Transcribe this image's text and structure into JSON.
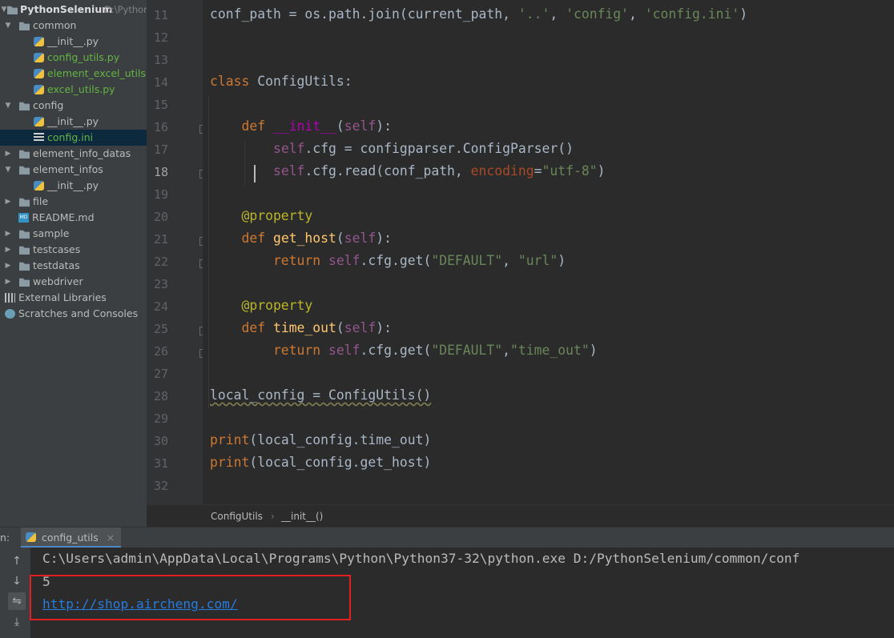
{
  "project_tree": {
    "root_name": "PythonSelenium",
    "root_path": "D:\\Pythor",
    "items": [
      {
        "label": "common",
        "type": "folder",
        "expanded": true
      },
      {
        "label": "__init__.py",
        "type": "py"
      },
      {
        "label": "config_utils.py",
        "type": "py",
        "status": "added"
      },
      {
        "label": "element_excel_utils.py",
        "type": "py",
        "status": "added"
      },
      {
        "label": "excel_utils.py",
        "type": "py",
        "status": "added"
      },
      {
        "label": "config",
        "type": "folder",
        "expanded": true
      },
      {
        "label": "__init__.py",
        "type": "py"
      },
      {
        "label": "config.ini",
        "type": "ini",
        "status": "added",
        "selected": true
      },
      {
        "label": "element_info_datas",
        "type": "folder",
        "expanded": false
      },
      {
        "label": "element_infos",
        "type": "folder",
        "expanded": true
      },
      {
        "label": "__init__.py",
        "type": "py"
      },
      {
        "label": "file",
        "type": "folder",
        "expanded": false
      },
      {
        "label": "README.md",
        "type": "md"
      },
      {
        "label": "sample",
        "type": "folder",
        "expanded": false
      },
      {
        "label": "testcases",
        "type": "folder",
        "expanded": false
      },
      {
        "label": "testdatas",
        "type": "folder",
        "expanded": false
      },
      {
        "label": "webdriver",
        "type": "folder",
        "expanded": false
      },
      {
        "label": "External Libraries",
        "type": "libs"
      },
      {
        "label": "Scratches and Consoles",
        "type": "scratches"
      }
    ]
  },
  "editor": {
    "line_numbers": [
      "11",
      "12",
      "13",
      "14",
      "15",
      "16",
      "17",
      "18",
      "19",
      "20",
      "21",
      "22",
      "23",
      "24",
      "25",
      "26",
      "27",
      "28",
      "29",
      "30",
      "31",
      "32"
    ],
    "current_line": "18",
    "lines": [
      {
        "n": "11",
        "tokens": [
          {
            "t": "conf_path = os.path.join(current_path, ",
            "c": "plain"
          },
          {
            "t": "'..'",
            "c": "str"
          },
          {
            "t": ", ",
            "c": "plain"
          },
          {
            "t": "'config'",
            "c": "str"
          },
          {
            "t": ", ",
            "c": "plain"
          },
          {
            "t": "'config.ini'",
            "c": "str"
          },
          {
            "t": ")",
            "c": "plain"
          }
        ]
      },
      {
        "n": "12",
        "tokens": []
      },
      {
        "n": "13",
        "tokens": []
      },
      {
        "n": "14",
        "tokens": [
          {
            "t": "class ",
            "c": "kw"
          },
          {
            "t": "ConfigUtils:",
            "c": "plain"
          }
        ]
      },
      {
        "n": "15",
        "tokens": []
      },
      {
        "n": "16",
        "tokens": [
          {
            "t": "    def ",
            "c": "kw"
          },
          {
            "t": "__init__",
            "c": "magic"
          },
          {
            "t": "(",
            "c": "plain"
          },
          {
            "t": "self",
            "c": "self"
          },
          {
            "t": "):",
            "c": "plain"
          }
        ]
      },
      {
        "n": "17",
        "tokens": [
          {
            "t": "        ",
            "c": "plain"
          },
          {
            "t": "self",
            "c": "self"
          },
          {
            "t": ".cfg = configparser.ConfigParser()",
            "c": "plain"
          }
        ]
      },
      {
        "n": "18",
        "tokens": [
          {
            "t": "        ",
            "c": "plain"
          },
          {
            "t": "self",
            "c": "self"
          },
          {
            "t": ".cfg.read(conf_path, ",
            "c": "plain"
          },
          {
            "t": "encoding",
            "c": "param"
          },
          {
            "t": "=",
            "c": "plain"
          },
          {
            "t": "\"utf-8\"",
            "c": "str"
          },
          {
            "t": ")",
            "c": "plain"
          }
        ]
      },
      {
        "n": "19",
        "tokens": []
      },
      {
        "n": "20",
        "tokens": [
          {
            "t": "    @property",
            "c": "deco"
          }
        ]
      },
      {
        "n": "21",
        "tokens": [
          {
            "t": "    def ",
            "c": "kw"
          },
          {
            "t": "get_host",
            "c": "fn"
          },
          {
            "t": "(",
            "c": "plain"
          },
          {
            "t": "self",
            "c": "self"
          },
          {
            "t": "):",
            "c": "plain"
          }
        ]
      },
      {
        "n": "22",
        "tokens": [
          {
            "t": "        return ",
            "c": "kw"
          },
          {
            "t": "self",
            "c": "self"
          },
          {
            "t": ".cfg.get(",
            "c": "plain"
          },
          {
            "t": "\"DEFAULT\"",
            "c": "str"
          },
          {
            "t": ", ",
            "c": "plain"
          },
          {
            "t": "\"url\"",
            "c": "str"
          },
          {
            "t": ")",
            "c": "plain"
          }
        ]
      },
      {
        "n": "23",
        "tokens": []
      },
      {
        "n": "24",
        "tokens": [
          {
            "t": "    @property",
            "c": "deco"
          }
        ]
      },
      {
        "n": "25",
        "tokens": [
          {
            "t": "    def ",
            "c": "kw"
          },
          {
            "t": "time_out",
            "c": "fn"
          },
          {
            "t": "(",
            "c": "plain"
          },
          {
            "t": "self",
            "c": "self"
          },
          {
            "t": "):",
            "c": "plain"
          }
        ]
      },
      {
        "n": "26",
        "tokens": [
          {
            "t": "        return ",
            "c": "kw"
          },
          {
            "t": "self",
            "c": "self"
          },
          {
            "t": ".cfg.get(",
            "c": "plain"
          },
          {
            "t": "\"DEFAULT\"",
            "c": "str"
          },
          {
            "t": ",",
            "c": "plain"
          },
          {
            "t": "\"time_out\"",
            "c": "str"
          },
          {
            "t": ")",
            "c": "plain"
          }
        ]
      },
      {
        "n": "27",
        "tokens": []
      },
      {
        "n": "28",
        "tokens": [
          {
            "t": "local_config = ConfigUtils()",
            "c": "plain wavy"
          }
        ]
      },
      {
        "n": "29",
        "tokens": []
      },
      {
        "n": "30",
        "tokens": [
          {
            "t": "print",
            "c": "kw"
          },
          {
            "t": "(local_config.time_out)",
            "c": "plain"
          }
        ]
      },
      {
        "n": "31",
        "tokens": [
          {
            "t": "print",
            "c": "kw"
          },
          {
            "t": "(local_config.get_host)",
            "c": "plain"
          }
        ]
      },
      {
        "n": "32",
        "tokens": []
      }
    ]
  },
  "breadcrumb": {
    "class_name": "ConfigUtils",
    "separator": "›",
    "method_name": "__init__()"
  },
  "run_panel": {
    "prefix": "n:",
    "tab_label": "config_utils",
    "tab_close": "×",
    "console_lines": {
      "command": "C:\\Users\\admin\\AppData\\Local\\Programs\\Python\\Python37-32\\python.exe D:/PythonSelenium/common/conf",
      "output_1": "5",
      "output_2": "http://shop.aircheng.com/"
    }
  },
  "colors": {
    "keyword": "#cc7832",
    "string": "#6a8759",
    "self": "#94558d",
    "function": "#ffc66d",
    "decorator": "#bbb529",
    "link": "#287bde",
    "highlight_box": "#e02020"
  }
}
